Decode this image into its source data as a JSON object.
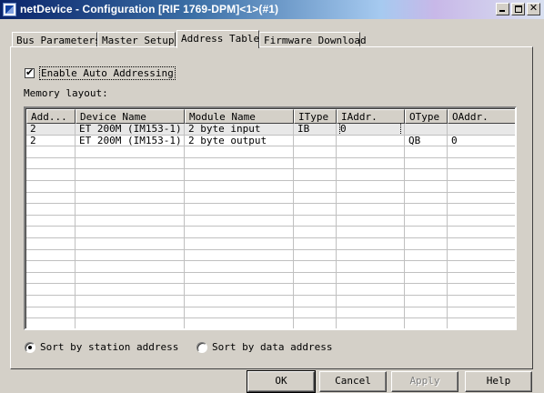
{
  "window": {
    "title": "netDevice - Configuration [RIF 1769-DPM]<1>(#1)",
    "minimize_label": "",
    "maximize_label": "",
    "close_label": "✕"
  },
  "tabs": [
    {
      "label": "Bus Parameters"
    },
    {
      "label": "Master Setup"
    },
    {
      "label": "Address Table",
      "active": true
    },
    {
      "label": "Firmware Download"
    }
  ],
  "auto_addressing": {
    "label": "Enable Auto Addressing",
    "checked": true,
    "check_glyph": "✔"
  },
  "memory_layout_label": "Memory layout:",
  "table": {
    "columns": [
      "Add...",
      "Device Name",
      "Module Name",
      "IType",
      "IAddr.",
      "OType",
      "OAddr."
    ],
    "rows": [
      [
        "2",
        "ET 200M (IM153-1)",
        "2 byte input",
        "IB",
        "0",
        "",
        ""
      ],
      [
        "2",
        "ET 200M (IM153-1)",
        "2 byte output",
        "",
        "",
        "QB",
        "0"
      ]
    ],
    "selected_row": 0
  },
  "sort": {
    "by_station": {
      "label": "Sort by station address",
      "selected": true
    },
    "by_data": {
      "label": "Sort by data address",
      "selected": false
    }
  },
  "buttons": {
    "ok": "OK",
    "cancel": "Cancel",
    "apply": "Apply",
    "help": "Help"
  },
  "colors": {
    "face": "#d4d0c8",
    "title_active": "#0a246a",
    "selected_row": "#e8e8e8"
  }
}
